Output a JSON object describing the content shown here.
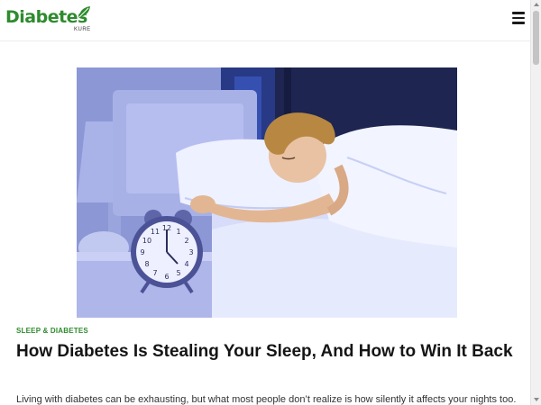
{
  "header": {
    "logo_text": "Diabetes",
    "logo_sub": "KURE",
    "menu_icon": "hamburger-menu-icon"
  },
  "article": {
    "category": "SLEEP & DIABETES",
    "title": "How Diabetes Is Stealing Your Sleep, And How to Win It Back",
    "excerpt": "Living with diabetes can be exhausting, but what most people don’t realize is how silently it affects your nights too."
  },
  "hero_image": {
    "clock": {
      "numbers": [
        "12",
        "1",
        "2",
        "3",
        "4",
        "5",
        "6",
        "7",
        "8",
        "9",
        "10",
        "11"
      ]
    }
  },
  "colors": {
    "brand_green": "#2e8b2e",
    "title_text": "#151515",
    "body_text": "#333333"
  }
}
